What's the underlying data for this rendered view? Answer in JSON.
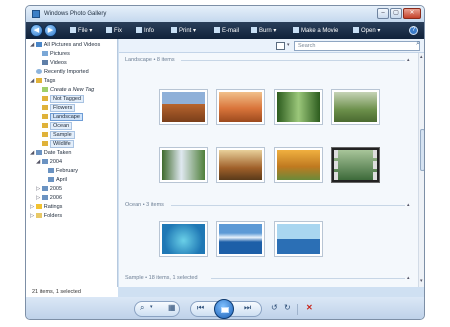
{
  "window": {
    "title": "Windows Photo Gallery"
  },
  "window_controls": {
    "minimize": "–",
    "maximize": "▢",
    "close": "✕"
  },
  "toolbar": {
    "back": "◀",
    "forward": "▶",
    "items": [
      {
        "label": "File",
        "icon": "file-icon"
      },
      {
        "label": "Fix",
        "icon": "fix-icon"
      },
      {
        "label": "Info",
        "icon": "info-icon"
      },
      {
        "label": "Print",
        "icon": "print-icon"
      },
      {
        "label": "E-mail",
        "icon": "email-icon"
      },
      {
        "label": "Burn",
        "icon": "burn-icon"
      },
      {
        "label": "Make a Movie",
        "icon": "movie-icon"
      },
      {
        "label": "Open",
        "icon": "open-icon"
      }
    ],
    "help": "?"
  },
  "sidebar": {
    "items": [
      {
        "label": "All Pictures and Videos",
        "icon": "pictures-icon"
      },
      {
        "label": "Pictures",
        "icon": "picture-icon"
      },
      {
        "label": "Videos",
        "icon": "video-icon"
      },
      {
        "label": "Recently Imported",
        "icon": "clock-icon"
      },
      {
        "label": "Tags",
        "icon": "tag-icon"
      },
      {
        "label": "Create a New Tag",
        "icon": "new-tag-icon"
      },
      {
        "label": "Not Tagged",
        "icon": "tag-icon"
      },
      {
        "label": "Flowers",
        "icon": "tag-icon"
      },
      {
        "label": "Landscape",
        "icon": "tag-icon"
      },
      {
        "label": "Ocean",
        "icon": "tag-icon"
      },
      {
        "label": "Sample",
        "icon": "tag-icon"
      },
      {
        "label": "Wildlife",
        "icon": "tag-icon"
      },
      {
        "label": "Date Taken",
        "icon": "calendar-icon"
      },
      {
        "label": "2004",
        "icon": "calendar-icon"
      },
      {
        "label": "February",
        "icon": "calendar-icon"
      },
      {
        "label": "April",
        "icon": "calendar-icon"
      },
      {
        "label": "2005",
        "icon": "calendar-icon"
      },
      {
        "label": "2006",
        "icon": "calendar-icon"
      },
      {
        "label": "Ratings",
        "icon": "star-icon"
      },
      {
        "label": "Folders",
        "icon": "folder-icon"
      }
    ]
  },
  "status": {
    "text": "21 items, 1 selected"
  },
  "search": {
    "placeholder": "Search"
  },
  "groups": [
    {
      "label": "Landscape • 8 items"
    },
    {
      "label": "Ocean • 3 items"
    },
    {
      "label": "Sample • 18 items, 1 selected"
    }
  ],
  "thumbnails": {
    "landscape": [
      {
        "name": "thumb-desert-mesa",
        "colors": [
          "#b8652e",
          "#7a9cc4"
        ]
      },
      {
        "name": "thumb-desert-dunes",
        "colors": [
          "#d9743a",
          "#8fb0d8"
        ]
      },
      {
        "name": "thumb-green-forest",
        "colors": [
          "#3f7a2c",
          "#b9d69a"
        ]
      },
      {
        "name": "thumb-river-valley",
        "colors": [
          "#6b8f4a",
          "#c6d3b6"
        ]
      },
      {
        "name": "thumb-waterfall",
        "colors": [
          "#4f7f3a",
          "#dfe8f0"
        ]
      },
      {
        "name": "thumb-autumn-tree",
        "colors": [
          "#a0602a",
          "#e8d09a"
        ]
      },
      {
        "name": "thumb-autumn-forest",
        "colors": [
          "#c07a20",
          "#6a8a3a"
        ]
      },
      {
        "name": "thumb-video-clip",
        "colors": [
          "#3d6a3a",
          "#a8c59a"
        ]
      }
    ],
    "ocean": [
      {
        "name": "thumb-sea-turtle",
        "colors": [
          "#1f78b5",
          "#5cc0e0"
        ]
      },
      {
        "name": "thumb-glacier",
        "colors": [
          "#1d5fa8",
          "#e8f2fb"
        ]
      },
      {
        "name": "thumb-whale-tail",
        "colors": [
          "#2b6fb5",
          "#a9d6f0"
        ]
      }
    ]
  },
  "bottom_controls": {
    "zoom": "⌕",
    "thumbnails_view": "▦",
    "previous": "⏮",
    "next": "⏭",
    "rotate_ccw": "↺",
    "rotate_cw": "↻",
    "delete": "✕"
  },
  "colors": {
    "accent": "#1b5fb5",
    "toolbar": "#1a2c47",
    "delete": "#c8251b"
  }
}
